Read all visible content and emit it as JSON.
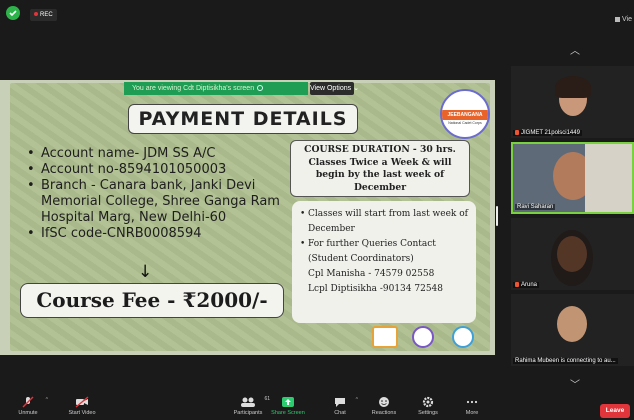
{
  "topbar": {
    "rec_label": "REC",
    "view_label": "Vie"
  },
  "share": {
    "viewing_banner": "You are viewing Cdt Diptisikha's screen",
    "view_options": "View Options"
  },
  "slide": {
    "title": "PAYMENT DETAILS",
    "logo": {
      "band": "JEEBANGANA",
      "sub": "National Cadet Corps"
    },
    "account_items": [
      "Account name- JDM SS A/C",
      "Account no-8594101050003",
      "Branch - Canara bank, Janki Devi Memorial College, Shree Ganga Ram Hospital Marg, New Delhi-60",
      "IfSC code-CNRB0008594"
    ],
    "arrow": "↓",
    "fee": "Course Fee - ₹2000/-",
    "duration": "COURSE DURATION - 30 hrs. Classes Twice a Week & will begin by the last week of December",
    "info_items": [
      "Classes will start from last week of December",
      "For further Queries Contact (Student Coordinators)"
    ],
    "contacts": [
      "Cpl Manisha - 74579 02558",
      "Lcpl Diptisikha -90134 72548"
    ]
  },
  "gallery": {
    "tiles": [
      {
        "name": "JIGMET 21polsci1449"
      },
      {
        "name": "Ravi Saharan"
      },
      {
        "name": "Aruna"
      },
      {
        "name": "Rahima Mubeen is connecting to au..."
      }
    ]
  },
  "toolbar": {
    "unmute": "Unmute",
    "start_video": "Start Video",
    "participants": "Participants",
    "participants_count": "61",
    "share_screen": "Share Screen",
    "chat": "Chat",
    "reactions": "Reactions",
    "settings": "Settings",
    "more": "More",
    "leave": "Leave"
  },
  "colors": {
    "share_green": "#2ecc71",
    "banner_green": "#1f9d55",
    "leave_red": "#e0353b",
    "active_speaker": "#7ad13f"
  }
}
